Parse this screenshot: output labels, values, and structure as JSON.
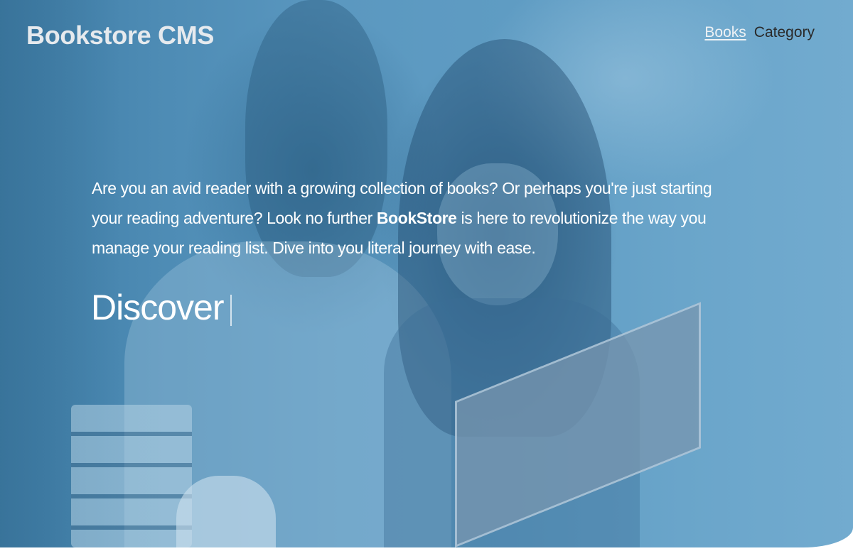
{
  "header": {
    "logo": "Bookstore CMS",
    "nav": [
      {
        "label": "Books",
        "active": true
      },
      {
        "label": "Category",
        "active": false
      }
    ]
  },
  "hero": {
    "intro_part1": "Are you an avid reader with a growing collection of books? Or perhaps you're just starting your reading adventure? Look no further ",
    "intro_brand": "BookStore",
    "intro_part2": " is here to revolutionize the way you manage your reading list. Dive into you literal journey with ease.",
    "typed_word": "Discover",
    "overlay_color": "#5b98c0"
  }
}
